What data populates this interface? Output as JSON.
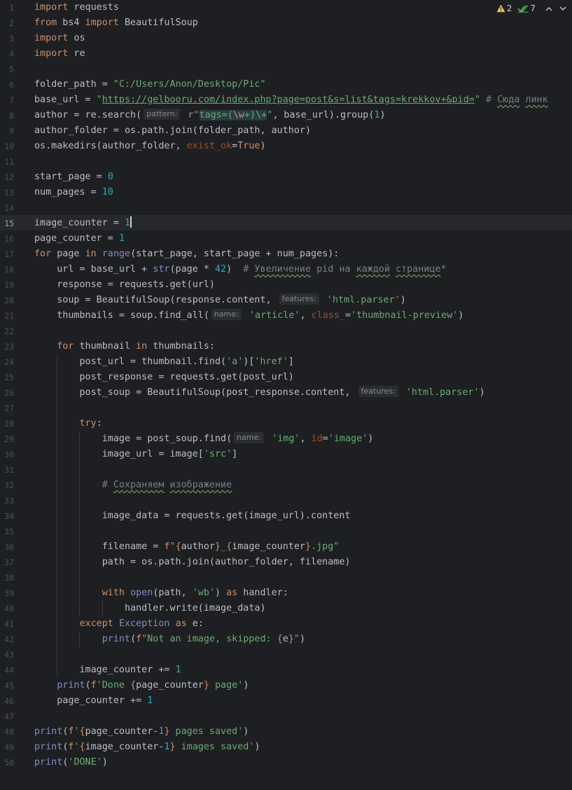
{
  "status": {
    "warnings": "2",
    "checks": "7"
  },
  "current_line": 15,
  "lines": [
    "import requests",
    "from bs4 import BeautifulSoup",
    "import os",
    "import re",
    "",
    "folder_path = \"C:/Users/Anon/Desktop/Pic\"",
    "base_url = \"https://gelbooru.com/index.php?page=post&s=list&tags=krekkov+&pid=\" # Сюда линк",
    "author = re.search(pattern: r\"tags=(\\w+)\\+\", base_url).group(1)",
    "author_folder = os.path.join(folder_path, author)",
    "os.makedirs(author_folder, exist_ok=True)",
    "",
    "start_page = 0",
    "num_pages = 10",
    "",
    "image_counter = 1",
    "page_counter = 1",
    "for page in range(start_page, start_page + num_pages):",
    "    url = base_url + str(page * 42)  # Увеличение pid на каждой странице*",
    "    response = requests.get(url)",
    "    soup = BeautifulSoup(response.content, features: 'html.parser')",
    "    thumbnails = soup.find_all(name: 'article', class_='thumbnail-preview')",
    "",
    "    for thumbnail in thumbnails:",
    "        post_url = thumbnail.find('a')['href']",
    "        post_response = requests.get(post_url)",
    "        post_soup = BeautifulSoup(post_response.content, features: 'html.parser')",
    "",
    "        try:",
    "            image = post_soup.find(name: 'img', id='image')",
    "            image_url = image['src']",
    "",
    "            # Сохраняем изображение",
    "",
    "            image_data = requests.get(image_url).content",
    "",
    "            filename = f\"{author}_{image_counter}.jpg\"",
    "            path = os.path.join(author_folder, filename)",
    "",
    "            with open(path, 'wb') as handler:",
    "                handler.write(image_data)",
    "        except Exception as e:",
    "            print(f\"Not an image, skipped: {e}\")",
    "",
    "        image_counter += 1",
    "    print(f'Done {page_counter} page')",
    "    page_counter += 1",
    "",
    "print(f'{page_counter-1} pages saved')",
    "print(f'{image_counter-1} images saved')",
    "print('DONE')"
  ],
  "colors": {
    "background": "#1e1f22",
    "keyword": "#cf8e6d",
    "string": "#6aab73",
    "number": "#2aacb8",
    "builtin": "#8888c6",
    "comment": "#7a7e85",
    "keyword_arg": "#aa4926",
    "warning": "#f2c55c",
    "ok": "#5fb865"
  }
}
